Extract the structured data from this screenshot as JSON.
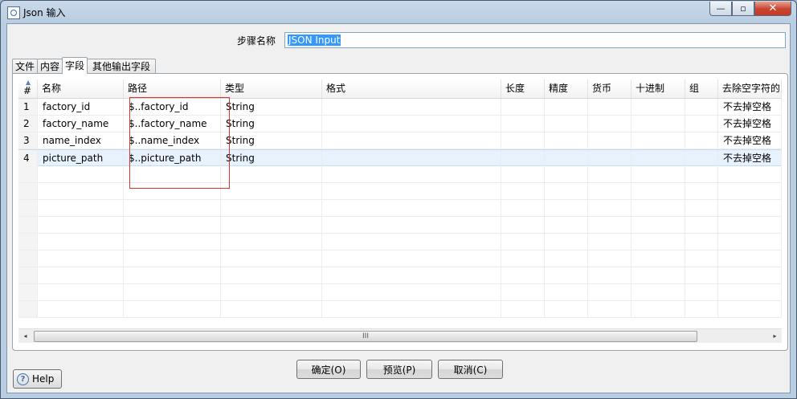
{
  "window": {
    "title": "Json 输入",
    "minimize": "—",
    "maximize": "▫",
    "close": "✕"
  },
  "step": {
    "label": "步骤名称",
    "value": "JSON Input"
  },
  "tabs": [
    {
      "label": "文件"
    },
    {
      "label": "内容"
    },
    {
      "label": "字段"
    },
    {
      "label": "其他输出字段"
    }
  ],
  "table": {
    "columns": [
      "#",
      "名称",
      "路径",
      "类型",
      "格式",
      "长度",
      "精度",
      "货币",
      "十进制",
      "组",
      "去除空字符的"
    ],
    "rows": [
      [
        "1",
        "factory_id",
        "$..factory_id",
        "String",
        "",
        "",
        "",
        "",
        "",
        "",
        "不去掉空格"
      ],
      [
        "2",
        "factory_name",
        "$..factory_name",
        "String",
        "",
        "",
        "",
        "",
        "",
        "",
        "不去掉空格"
      ],
      [
        "3",
        "name_index",
        "$..name_index",
        "String",
        "",
        "",
        "",
        "",
        "",
        "",
        "不去掉空格"
      ],
      [
        "4",
        "picture_path",
        "$..picture_path",
        "String",
        "",
        "",
        "",
        "",
        "",
        "",
        "不去掉空格"
      ]
    ],
    "selected_row": 4
  },
  "scrollbar": {
    "grip": "III",
    "left_arrow": "◂",
    "right_arrow": "▸"
  },
  "buttons": {
    "ok": "确定(O)",
    "preview": "预览(P)",
    "cancel": "取消(C)",
    "help": "Help",
    "help_glyph": "?"
  },
  "colors": {
    "highlight_border": "#d9332a",
    "selection": "#3399ff"
  }
}
